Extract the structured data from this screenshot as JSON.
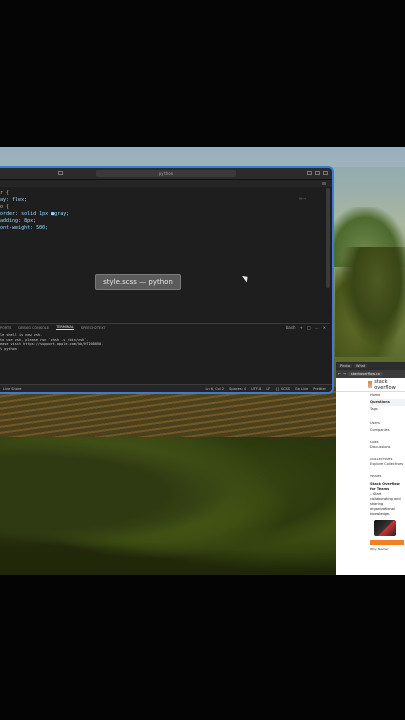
{
  "editor": {
    "window_title": "python",
    "code_lines": [
      {
        "text": "r {",
        "kind": "sel"
      },
      {
        "text": "ay: flex;",
        "kind": "prop"
      },
      {
        "text": "o {",
        "kind": "sel"
      },
      {
        "text": "order: solid 1px ■gray;",
        "kind": "prop"
      },
      {
        "text": "adding: 8px;",
        "kind": "prop"
      },
      {
        "text": "ont-weight: 500;",
        "kind": "prop"
      }
    ],
    "hint": "⌘←→",
    "tooltip": "style.scss — python",
    "panel_tabs": [
      "PORTS",
      "DEBUG CONSOLE",
      "TERMINAL",
      "SPEECH2TEXT"
    ],
    "active_panel_tab": "TERMINAL",
    "panel_actions": [
      "bash",
      "+",
      "□",
      "…",
      "✕"
    ],
    "terminal_lines": [
      "le shell is now zsh.",
      "to use zsh, please run `chsh -s /bin/zsh`.",
      "ease visit https://support.apple.com/kb/HT208050.",
      "% python"
    ],
    "status_left": "Live Share",
    "status_right": [
      "Ln 6, Col 2",
      "Spaces: 4",
      "UTF-8",
      "LF",
      "{} SCSS",
      "Go Live",
      "Prettier"
    ]
  },
  "browser": {
    "tabs": [
      "Photo",
      "What"
    ],
    "url": "stackoverflow.co",
    "header_title": "stack overflow",
    "nav": [
      "Home",
      "Questions",
      "Tags",
      "",
      "Users",
      "Companies"
    ],
    "active_nav": "Questions",
    "labs_label": "LABS",
    "discussions": "Discussions",
    "collectives_label": "COLLECTIVES",
    "explore": "Explore Collectives",
    "teams_label": "TEAMS",
    "teams_title": "Stack Overflow for Teams",
    "teams_body": "– Start collaborating and sharing organizational knowledge.",
    "footer": "Why Teams?"
  }
}
